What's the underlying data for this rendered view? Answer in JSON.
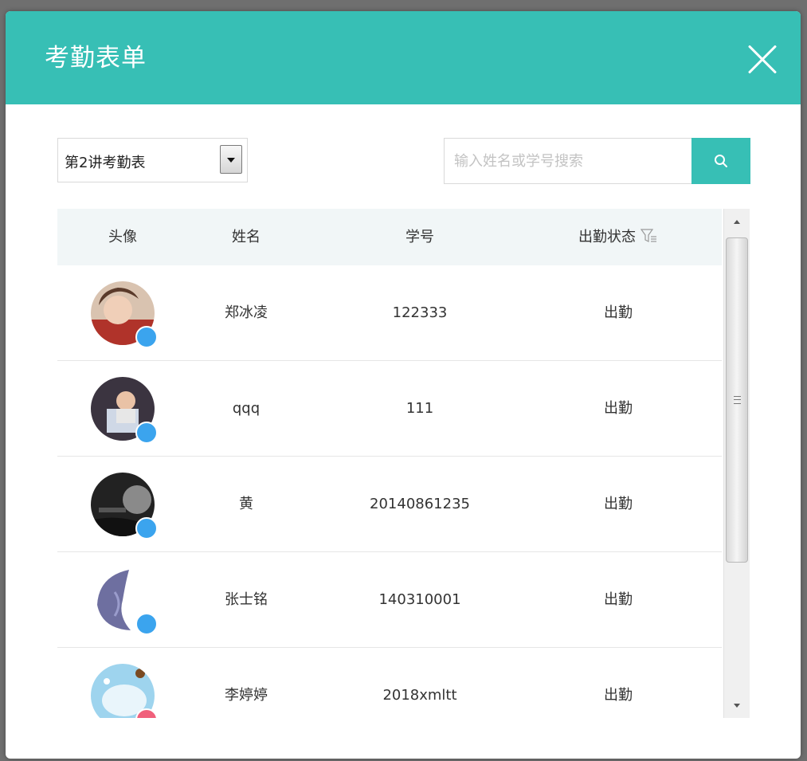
{
  "dialog": {
    "title": "考勤表单"
  },
  "toolbar": {
    "lecture_select_value": "第2讲考勤表",
    "search_placeholder": "输入姓名或学号搜索"
  },
  "table": {
    "headers": {
      "avatar": "头像",
      "name": "姓名",
      "student_id": "学号",
      "status": "出勤状态"
    },
    "rows": [
      {
        "name": "郑冰凌",
        "student_id": "122333",
        "status": "出勤",
        "gender": "male"
      },
      {
        "name": "qqq",
        "student_id": "111",
        "status": "出勤",
        "gender": "male"
      },
      {
        "name": "黄",
        "student_id": "20140861235",
        "status": "出勤",
        "gender": "male"
      },
      {
        "name": "张士铭",
        "student_id": "140310001",
        "status": "出勤",
        "gender": "male"
      },
      {
        "name": "李婷婷",
        "student_id": "2018xmltt",
        "status": "出勤",
        "gender": "female"
      }
    ]
  },
  "colors": {
    "accent": "#37bfb5",
    "header_row_bg": "#f1f6f7",
    "male_badge": "#3ba4ee",
    "female_badge": "#f0607b"
  },
  "icons": {
    "close": "close-icon",
    "search": "search-icon",
    "filter": "filter-icon",
    "dropdown": "chevron-down-icon",
    "gender_male": "male-icon",
    "gender_female": "female-icon"
  }
}
